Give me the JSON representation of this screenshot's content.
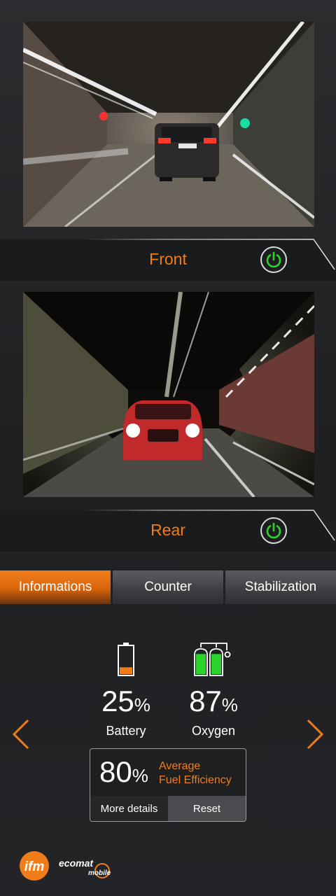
{
  "cameras": [
    {
      "label": "Front",
      "power": "on",
      "power_icon": "power-icon",
      "power_color": "#2bd42b"
    },
    {
      "label": "Rear",
      "power": "on",
      "power_icon": "power-icon",
      "power_color": "#2bd42b"
    }
  ],
  "tabs": [
    {
      "label": "Informations",
      "active": true
    },
    {
      "label": "Counter",
      "active": false
    },
    {
      "label": "Stabilization",
      "active": false
    }
  ],
  "stats": {
    "battery": {
      "value": "25",
      "unit": "%",
      "label": "Battery",
      "level": 0.25,
      "icon": "battery-icon"
    },
    "oxygen": {
      "value": "87",
      "unit": "%",
      "label": "Oxygen",
      "level": 0.87,
      "icon": "oxygen-tanks-icon"
    }
  },
  "fuel": {
    "value": "80",
    "unit": "%",
    "label_line1": "Average",
    "label_line2": "Fuel Efficiency",
    "details_label": "More details",
    "reset_label": "Reset"
  },
  "nav": {
    "prev_icon": "chevron-left-icon",
    "next_icon": "chevron-right-icon"
  },
  "logos": {
    "ifm": "ifm",
    "ecomat_line1": "ecomat",
    "ecomat_line2": "mobile"
  },
  "colors": {
    "accent": "#f07d19",
    "status_ok": "#2bd42b",
    "background": "#232427"
  }
}
